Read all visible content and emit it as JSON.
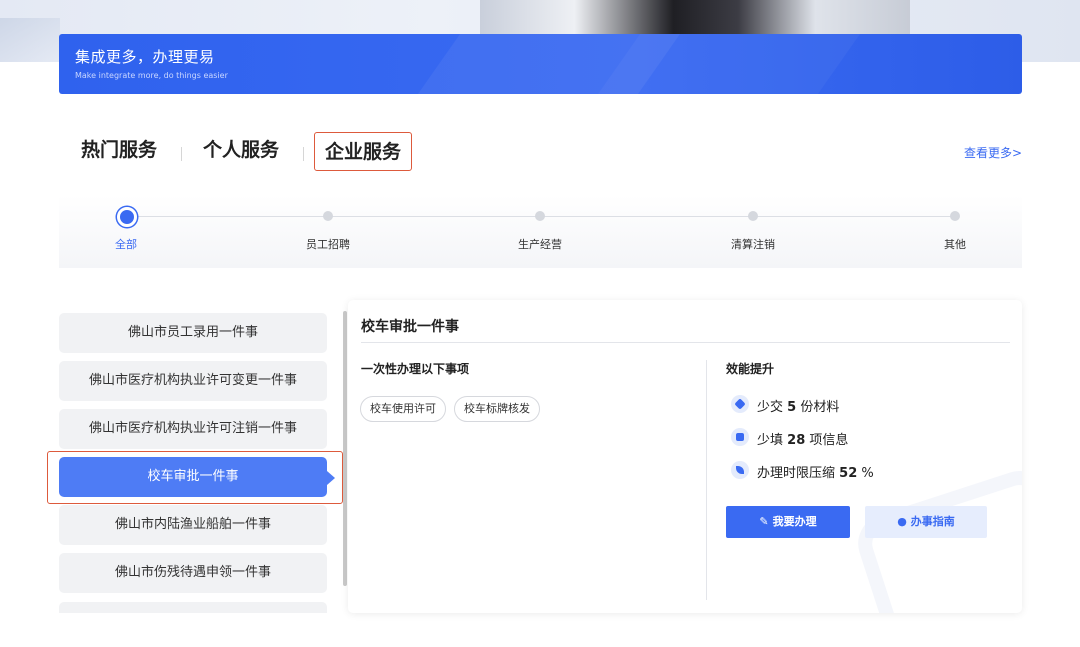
{
  "banner": {
    "title": "集成更多，办理更易",
    "subtitle": "Make integrate more, do things easier"
  },
  "tabs": [
    {
      "label": "热门服务",
      "active": false
    },
    {
      "label": "个人服务",
      "active": false
    },
    {
      "label": "企业服务",
      "active": true
    }
  ],
  "more_link": "查看更多>",
  "steps": [
    {
      "label": "全部",
      "active": true
    },
    {
      "label": "员工招聘",
      "active": false
    },
    {
      "label": "生产经营",
      "active": false
    },
    {
      "label": "清算注销",
      "active": false
    },
    {
      "label": "其他",
      "active": false
    }
  ],
  "service_list": [
    {
      "label": "佛山市员工录用一件事",
      "active": false
    },
    {
      "label": "佛山市医疗机构执业许可变更一件事",
      "active": false
    },
    {
      "label": "佛山市医疗机构执业许可注销一件事",
      "active": false
    },
    {
      "label": "校车审批一件事",
      "active": true
    },
    {
      "label": "佛山市内陆渔业船舶一件事",
      "active": false
    },
    {
      "label": "佛山市伤残待遇申领一件事",
      "active": false
    }
  ],
  "detail": {
    "title": "校车审批一件事",
    "items_heading": "一次性办理以下事项",
    "items": [
      "校车使用许可",
      "校车标牌核发"
    ],
    "efficiency_heading": "效能提升",
    "efficiency": [
      {
        "prefix": "少交",
        "value": "5",
        "suffix": "份材料",
        "icon": "layers-icon"
      },
      {
        "prefix": "少填",
        "value": "28",
        "suffix": "项信息",
        "icon": "calendar-icon"
      },
      {
        "prefix": "办理时限压缩",
        "value": "52",
        "suffix": "%",
        "icon": "feather-icon"
      }
    ],
    "apply_button": "我要办理",
    "guide_button": "办事指南"
  },
  "colors": {
    "accent": "#3a6af2",
    "highlight_border": "#dd5a3c",
    "active_item": "#4e7cf5"
  }
}
